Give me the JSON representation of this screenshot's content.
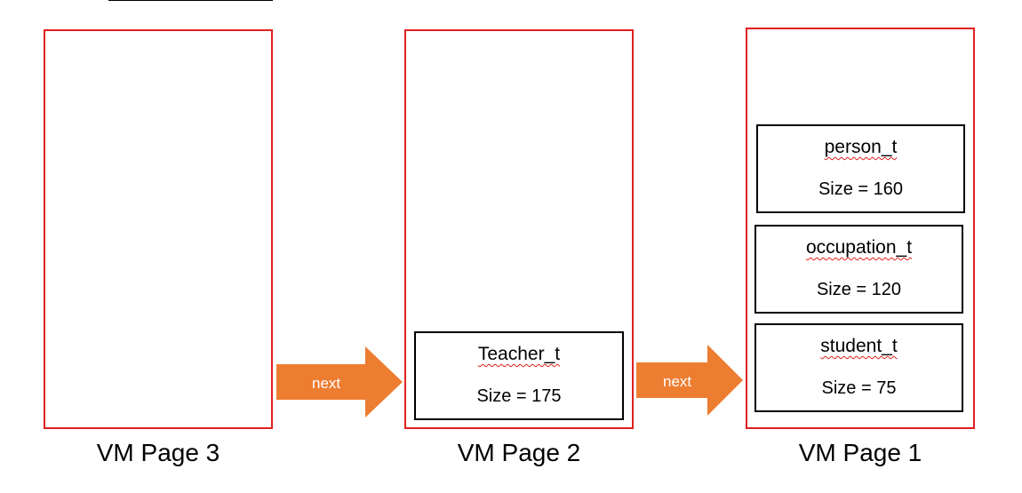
{
  "colors": {
    "page_border": "#e02020",
    "block_border": "#000000",
    "arrow_fill": "#ed7d31",
    "arrow_text": "#ffffff"
  },
  "pages": [
    {
      "label": "VM Page 3",
      "blocks": []
    },
    {
      "label": "VM Page 2",
      "blocks": [
        {
          "name": "Teacher_t",
          "size": "Size = 175"
        }
      ]
    },
    {
      "label": "VM Page 1",
      "blocks": [
        {
          "name": "person_t",
          "size": "Size = 160"
        },
        {
          "name": "occupation_t",
          "size": "Size = 120"
        },
        {
          "name": "student_t",
          "size": "Size = 75"
        }
      ]
    }
  ],
  "arrows": [
    {
      "label": "next"
    },
    {
      "label": "next"
    }
  ]
}
